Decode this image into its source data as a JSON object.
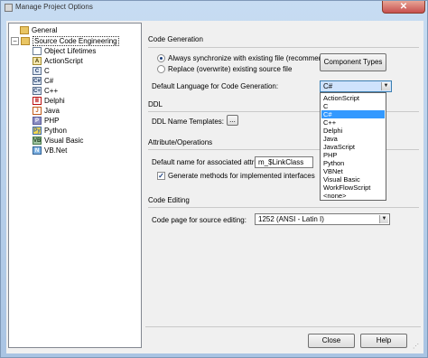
{
  "window": {
    "title": "Manage Project Options",
    "close_glyph": "✕"
  },
  "tree": {
    "expander": "−",
    "items": [
      {
        "label": "General",
        "icon": "folder-icon"
      },
      {
        "label": "Source Code Engineering",
        "icon": "folder-icon"
      },
      {
        "label": "Object Lifetimes",
        "icon": "document-icon"
      },
      {
        "label": "ActionScript",
        "icon": "actionscript-icon"
      },
      {
        "label": "C",
        "icon": "c-language-icon"
      },
      {
        "label": "C#",
        "icon": "csharp-icon"
      },
      {
        "label": "C++",
        "icon": "cplusplus-icon"
      },
      {
        "label": "Delphi",
        "icon": "delphi-icon"
      },
      {
        "label": "Java",
        "icon": "java-icon"
      },
      {
        "label": "PHP",
        "icon": "php-icon"
      },
      {
        "label": "Python",
        "icon": "python-icon"
      },
      {
        "label": "Visual Basic",
        "icon": "visual-basic-icon"
      },
      {
        "label": "VB.Net",
        "icon": "vbnet-icon"
      }
    ],
    "icon_glyphs": {
      "c": "C",
      "csharp": "C#",
      "cpp": "C+",
      "js": "A",
      "delphi": "Ⅲ",
      "java": "J",
      "php": "P",
      "py": "Py",
      "vb": "VB",
      "net": "N"
    }
  },
  "code_generation": {
    "heading": "Code Generation",
    "radio_sync": "Always synchronize with existing file (recommended)",
    "radio_replace": "Replace (overwrite) existing source file",
    "component_types_button": "Component Types",
    "default_language_label": "Default Language for Code Generation:",
    "default_language_value": "C#",
    "dropdown_arrow": "▼"
  },
  "language_options": [
    "ActionScript",
    "C",
    "C#",
    "C++",
    "Delphi",
    "Java",
    "JavaScript",
    "PHP",
    "Python",
    "VBNet",
    "Visual Basic",
    "WorkFlowScript",
    "<none>"
  ],
  "selected_language_index": 2,
  "ddl": {
    "heading": "DDL",
    "name_templates_label": "DDL Name Templates:",
    "ellipsis_button": "..."
  },
  "attribute_operations": {
    "heading": "Attribute/Operations",
    "default_name_label": "Default name for associated attrib:",
    "default_name_value": "m_$LinkClass",
    "generate_methods_label": "Generate methods for implemented interfaces",
    "generate_methods_checked": true,
    "check_glyph": "✓"
  },
  "code_editing": {
    "heading": "Code Editing",
    "code_page_label": "Code page for source editing:",
    "code_page_value": "1252  (ANSI - Latin I)"
  },
  "footer": {
    "close_button": "Close",
    "help_button": "Help"
  }
}
